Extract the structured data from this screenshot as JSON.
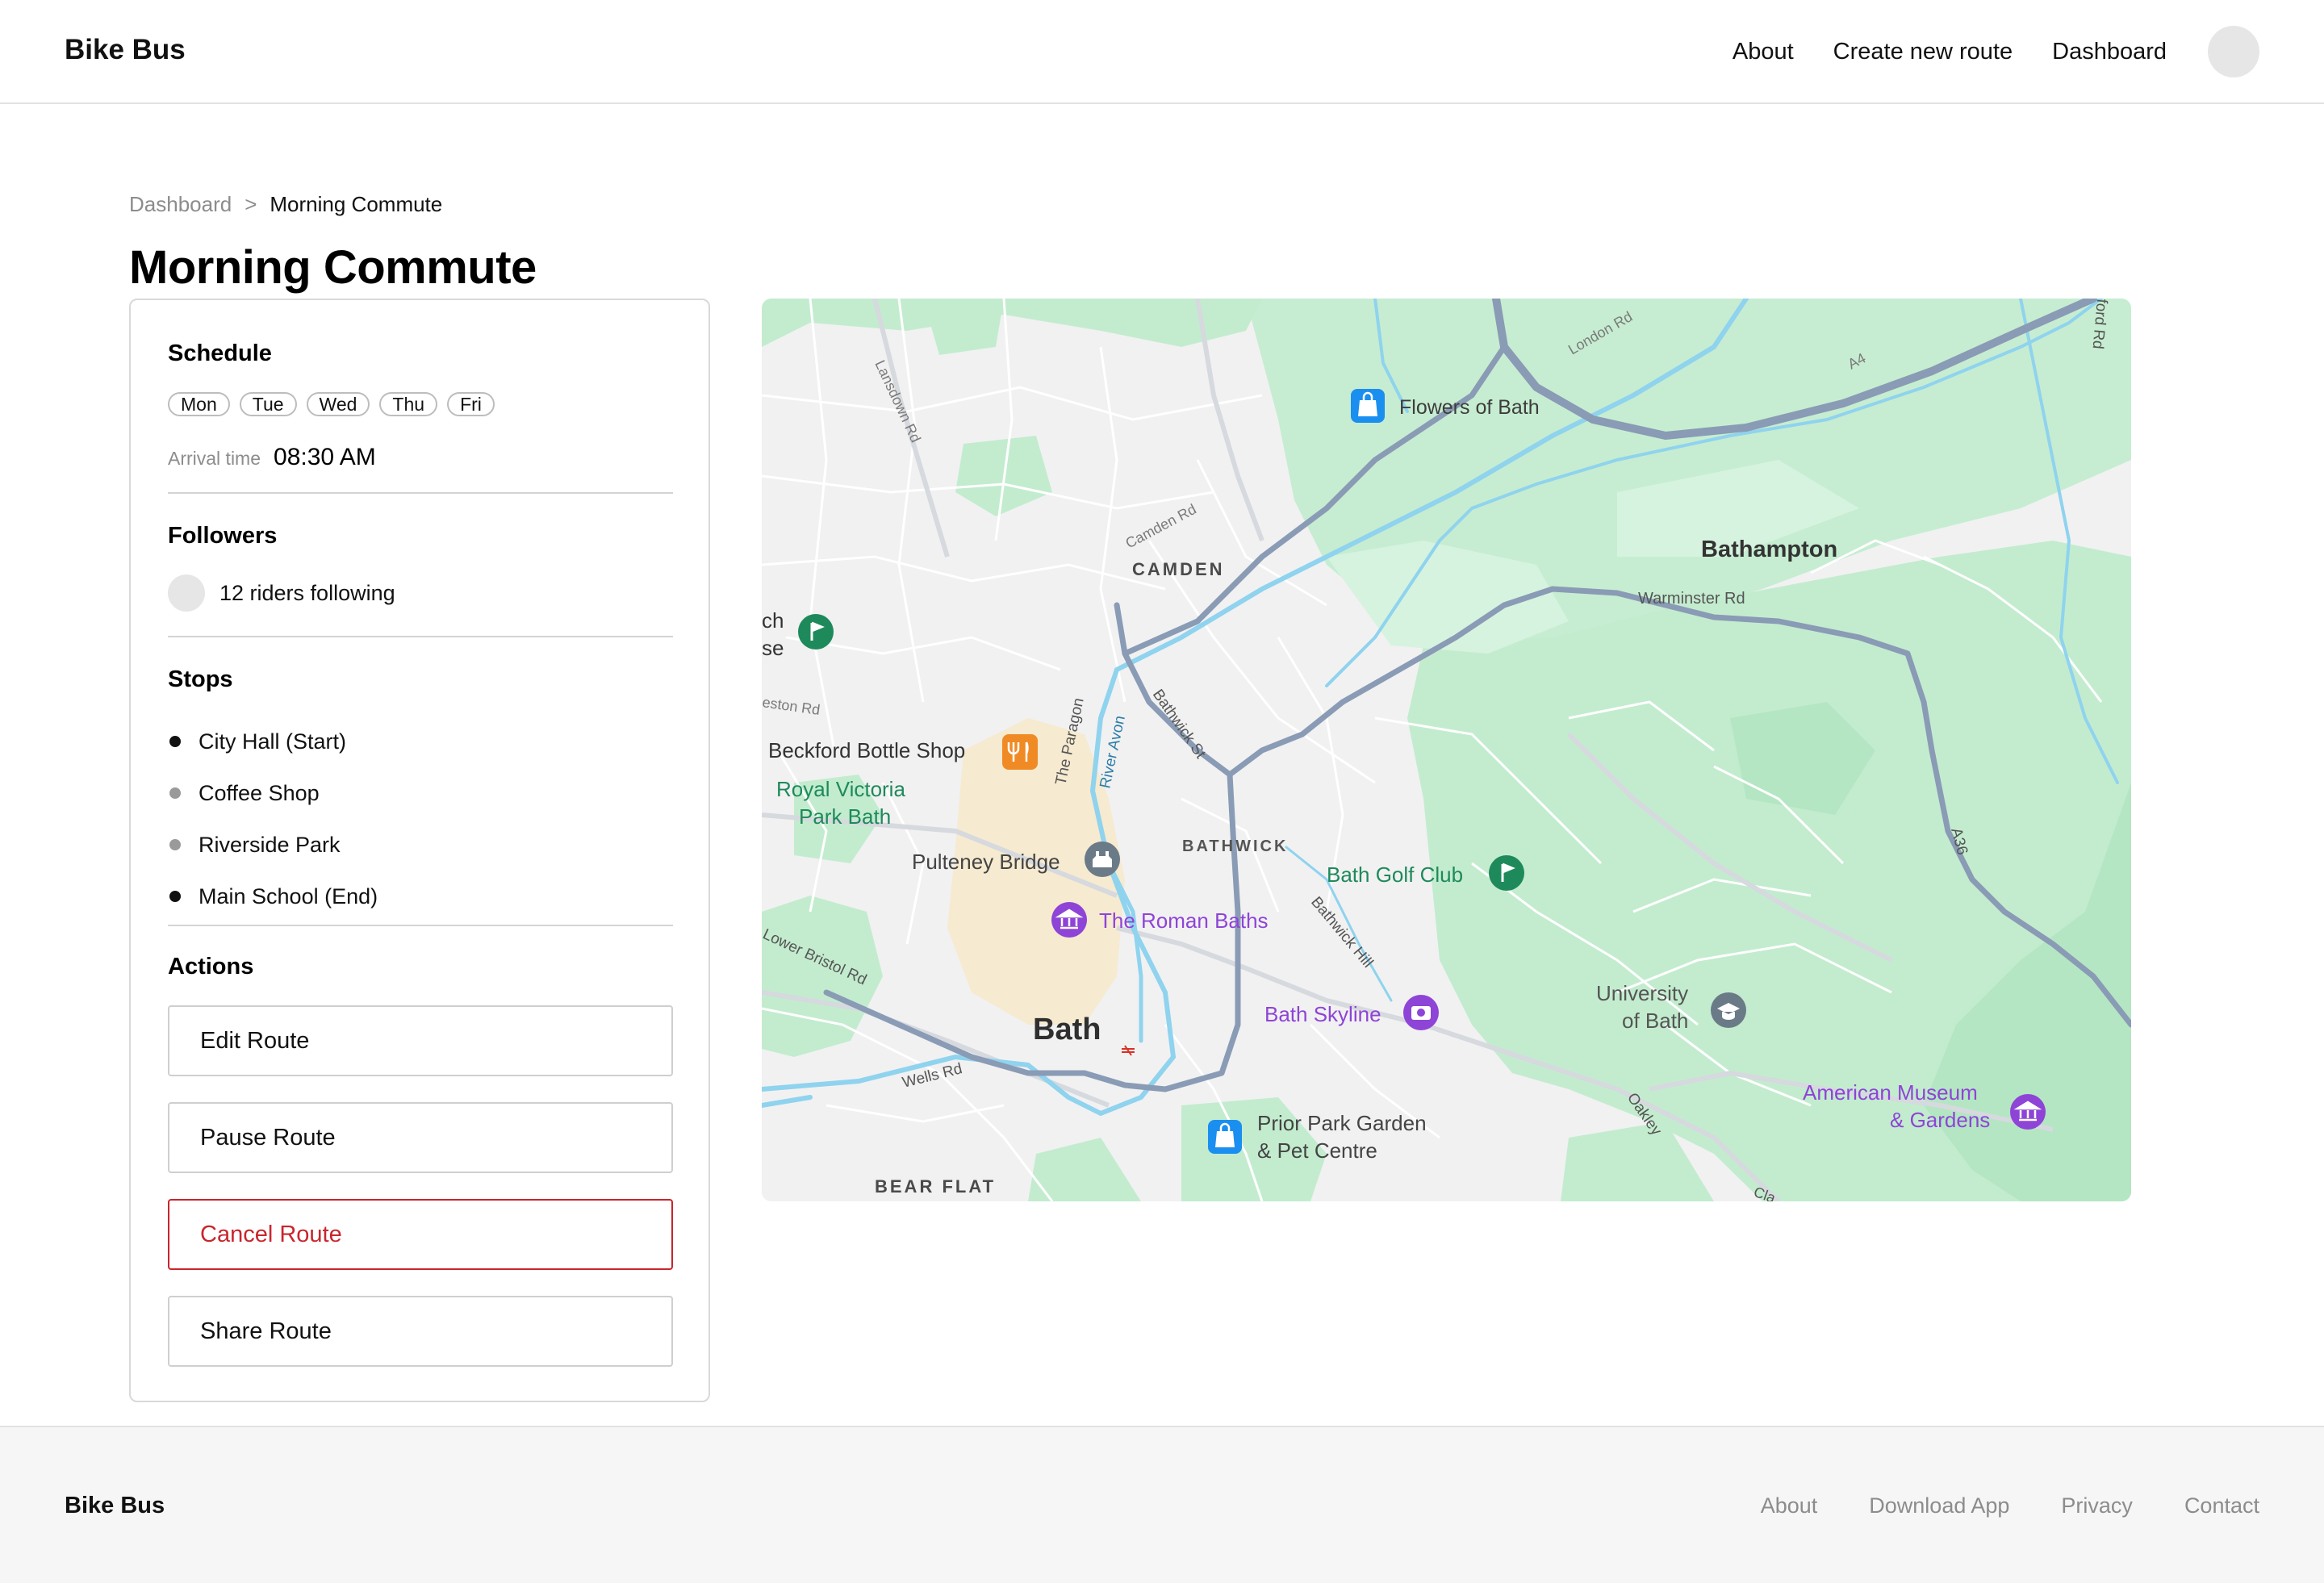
{
  "header": {
    "brand": "Bike Bus",
    "nav": [
      "About",
      "Create new route",
      "Dashboard"
    ]
  },
  "breadcrumb": {
    "parent": "Dashboard",
    "separator": ">",
    "current": "Morning Commute"
  },
  "page_title": "Morning Commute",
  "schedule": {
    "title": "Schedule",
    "days": [
      "Mon",
      "Tue",
      "Wed",
      "Thu",
      "Fri"
    ],
    "arrival_label": "Arrival time",
    "arrival_value": "08:30 AM"
  },
  "followers": {
    "title": "Followers",
    "text": "12 riders following"
  },
  "stops": {
    "title": "Stops",
    "items": [
      {
        "label": "City Hall (Start)",
        "marker": "dark"
      },
      {
        "label": "Coffee Shop",
        "marker": "gray"
      },
      {
        "label": "Riverside Park",
        "marker": "gray"
      },
      {
        "label": "Main School (End)",
        "marker": "dark"
      }
    ]
  },
  "actions": {
    "title": "Actions",
    "edit": "Edit Route",
    "pause": "Pause Route",
    "cancel": "Cancel Route",
    "share": "Share Route"
  },
  "map": {
    "places": {
      "flowers": "Flowers of Bath",
      "camden": "CAMDEN",
      "camden_rd": "Camden Rd",
      "lansdown_rd": "Lansdown Rd",
      "london_rd": "London Rd",
      "a4": "A4",
      "bathampton": "Bathampton",
      "warminster_rd": "Warminster Rd",
      "ch": "ch",
      "se": "se",
      "weston_rd": "eston Rd",
      "beckford": "Beckford Bottle Shop",
      "the_paragon": "The Paragon",
      "river_avon": "River Avon",
      "bathwick_st": "Bathwick St",
      "royal_victoria_1": "Royal Victoria",
      "royal_victoria_2": "Park Bath",
      "pulteney": "Pulteney Bridge",
      "bathwick": "BATHWICK",
      "golf": "Bath Golf Club",
      "roman_baths": "The Roman Baths",
      "bathwick_hill": "Bathwick Hill",
      "lower_bristol": "Lower Bristol Rd",
      "bath": "Bath",
      "skyline": "Bath Skyline",
      "university_1": "University",
      "university_2": "of Bath",
      "american_museum_1": "American Museum",
      "american_museum_2": "& Gardens",
      "wells_rd": "Wells Rd",
      "prior_park_1": "Prior Park Garden",
      "prior_park_2": "& Pet Centre",
      "oakley": "Oakley",
      "bear_flat": "BEAR FLAT",
      "a36": "A36",
      "ford_rd": "ford Rd",
      "cla": "Cla"
    },
    "colors": {
      "land": "#f1f1f2",
      "park": "#c3eccf",
      "town": "#f6ead0",
      "water": "#8fd3ee",
      "major_road": "#8a9bb5",
      "minor_road": "#ffffff",
      "poi_green": "#1e8a5b",
      "poi_purple": "#8e44d6",
      "poi_blue": "#1a8ff0",
      "poi_orange": "#f08a24",
      "poi_gray": "#6b7a87"
    }
  },
  "footer": {
    "brand": "Bike Bus",
    "links": [
      "About",
      "Download App",
      "Privacy",
      "Contact"
    ]
  }
}
